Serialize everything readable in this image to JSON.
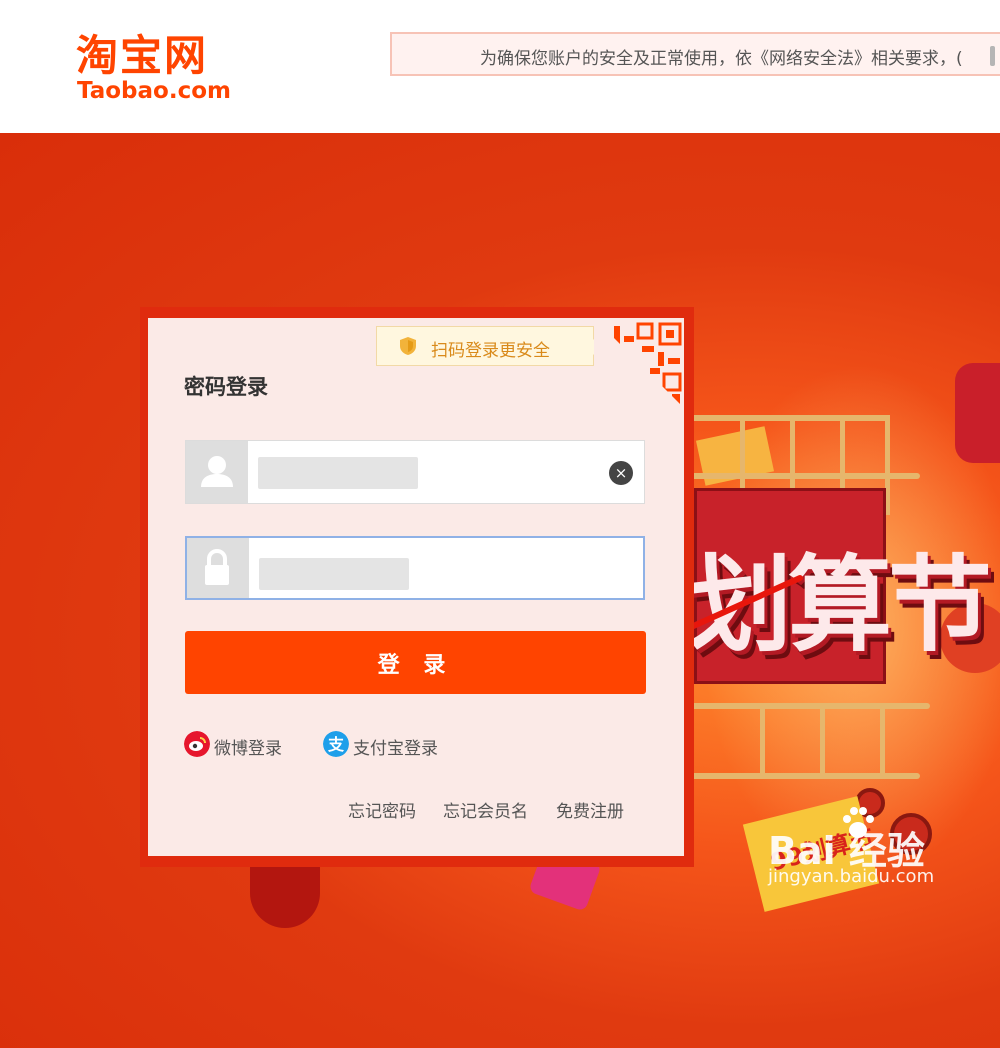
{
  "header": {
    "logo_cn": "淘宝网",
    "logo_en": "Taobao.com",
    "notice": "为确保您账户的安全及正常使用，依《网络安全法》相关要求，("
  },
  "banner": {
    "festival_text": "划算节",
    "ticket_text": "99划算节"
  },
  "login": {
    "qr_tip": "扫码登录更安全",
    "title": "密码登录",
    "submit_label": "登 录",
    "alt_weibo": "微博登录",
    "alt_alipay": "支付宝登录",
    "forgot_password": "忘记密码",
    "forgot_username": "忘记会员名",
    "register": "免费注册"
  },
  "watermark": {
    "brand": "Bai 经验",
    "url": "jingyan.baidu.com"
  },
  "colors": {
    "brand_orange": "#ff4400",
    "banner_red": "#d92e0a",
    "form_bg": "#fbeae7"
  },
  "icons": [
    "user-icon",
    "lock-icon",
    "clear-icon",
    "shield-icon",
    "qr-code-icon",
    "weibo-icon",
    "alipay-icon",
    "red-arrow-annotation"
  ]
}
